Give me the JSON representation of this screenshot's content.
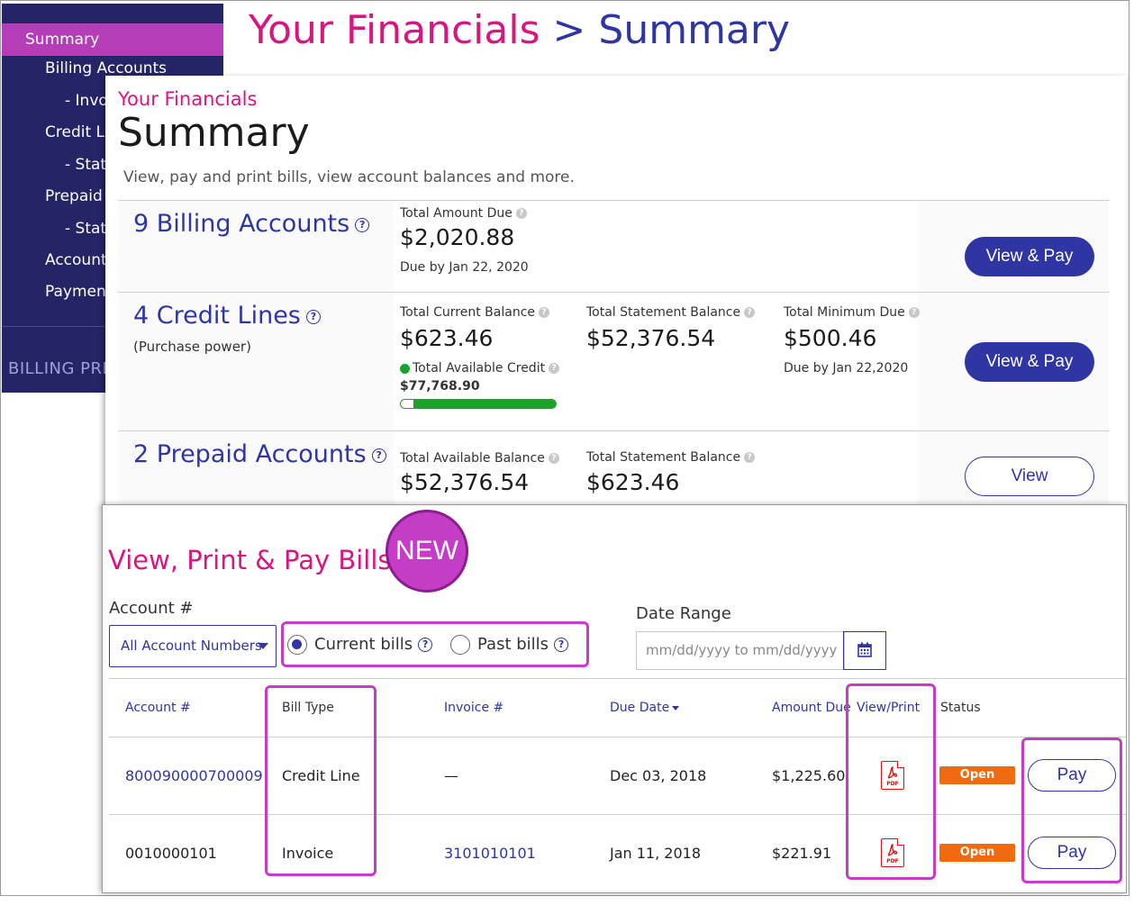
{
  "header": {
    "breadcrumb_pink": "Your Financials",
    "breadcrumb_sep": ">",
    "breadcrumb_blue": "Summary"
  },
  "sidebar": {
    "items": [
      {
        "label": "Summary"
      },
      {
        "label": "Billing Accounts"
      },
      {
        "label": "- Invo"
      },
      {
        "label": "Credit Li"
      },
      {
        "label": "- State"
      },
      {
        "label": "Prepaid A"
      },
      {
        "label": "- State"
      },
      {
        "label": "Account"
      },
      {
        "label": "Payment"
      }
    ],
    "footer": "BILLING PRE"
  },
  "summary": {
    "eyebrow": "Your Financials",
    "title": "Summary",
    "subtitle": "View, pay and print bills, view account balances and more.",
    "billing": {
      "title": "9 Billing Accounts",
      "total_due_label": "Total Amount Due",
      "total_due": "$2,020.88",
      "due_by": "Due by Jan 22, 2020",
      "button": "View & Pay"
    },
    "credit": {
      "title": "4 Credit Lines",
      "subtitle": "(Purchase power)",
      "current_label": "Total Current Balance",
      "current": "$623.46",
      "available_label": "Total Available Credit",
      "available": "$77,768.90",
      "available_fraction": 0.92,
      "statement_label": "Total Statement Balance",
      "statement": "$52,376.54",
      "minimum_label": "Total Minimum Due",
      "minimum": "$500.46",
      "minimum_due_by": "Due by Jan 22,2020",
      "button": "View & Pay"
    },
    "prepaid": {
      "title": "2 Prepaid Accounts",
      "available_label": "Total Available Balance",
      "available": "$52,376.54",
      "statement_label": "Total Statement Balance",
      "statement": "$623.46",
      "button": "View"
    }
  },
  "bills": {
    "title": "View, Print & Pay Bills",
    "badge": "NEW",
    "account_label": "Account #",
    "account_select": "All Account Numbers",
    "radio_current": "Current bills",
    "radio_past": "Past bills",
    "date_label": "Date Range",
    "date_placeholder": "mm/dd/yyyy to mm/dd/yyyy",
    "columns": {
      "account": "Account #",
      "bill_type": "Bill Type",
      "invoice": "Invoice #",
      "due_date": "Due Date",
      "amount": "Amount Due",
      "view_print": "View/Print",
      "status": "Status"
    },
    "rows": [
      {
        "account": "800090000700009",
        "bill_type": "Credit Line",
        "invoice": "—",
        "due_date": "Dec 03, 2018",
        "amount": "$1,225.60",
        "pdf": "PDF",
        "status": "Open",
        "pay": "Pay"
      },
      {
        "account": "0010000101",
        "bill_type": "Invoice",
        "invoice": "3101010101",
        "due_date": "Jan 11, 2018",
        "amount": "$221.91",
        "pdf": "PDF",
        "status": "Open",
        "pay": "Pay"
      }
    ]
  },
  "colors": {
    "brand_blue": "#2f35a2",
    "brand_pink": "#d8167f",
    "highlight": "#c53dc7",
    "status_open": "#f06a0f",
    "progress_green": "#1aa32b"
  }
}
